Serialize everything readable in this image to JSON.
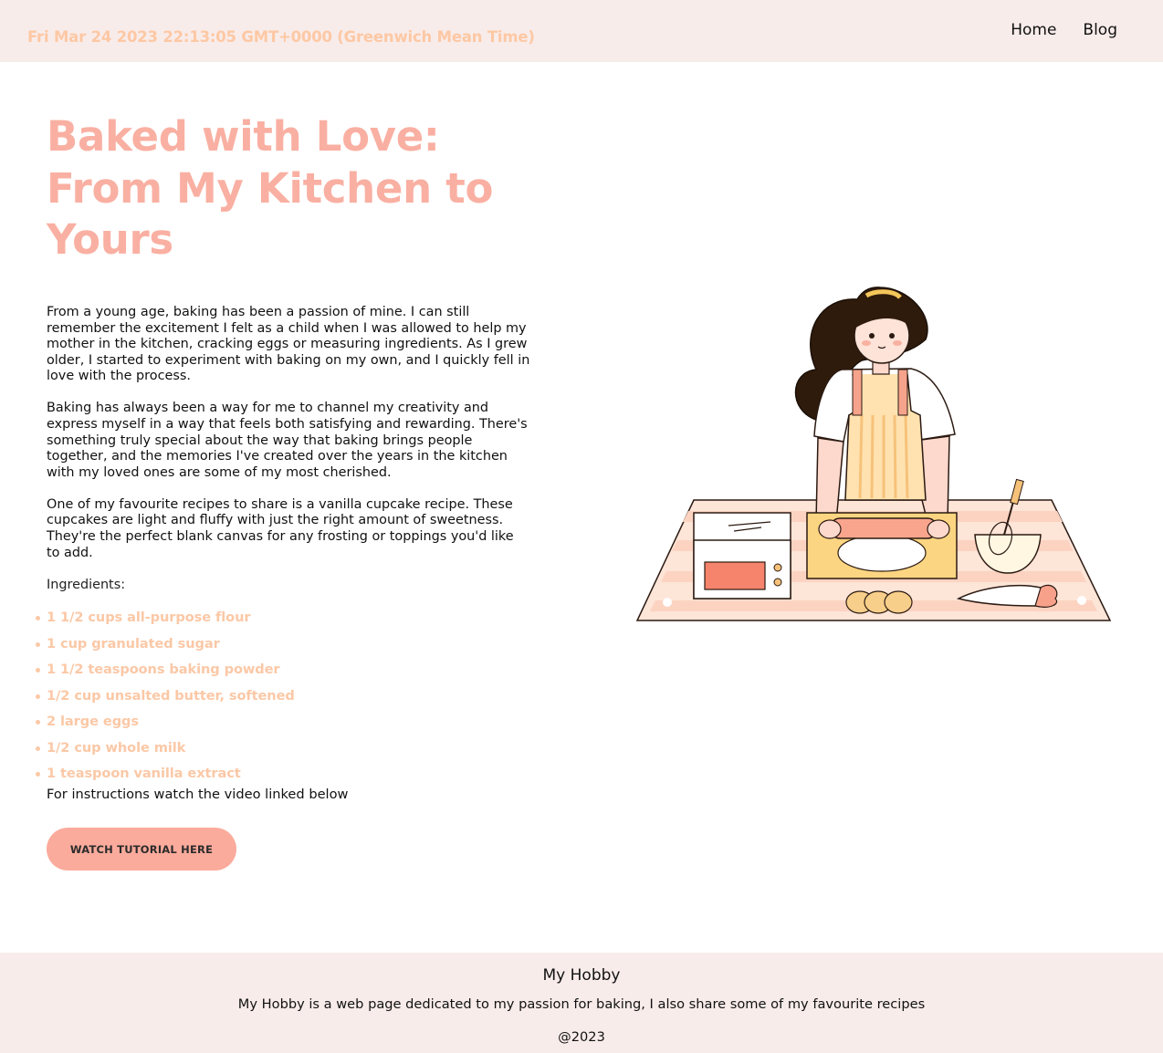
{
  "header": {
    "datetime": "Fri Mar 24 2023 22:13:05 GMT+0000 (Greenwich Mean Time)",
    "nav": [
      {
        "label": "Home"
      },
      {
        "label": "Blog"
      }
    ]
  },
  "hero": {
    "title": "Baked with Love: From My Kitchen to Yours"
  },
  "content": {
    "paragraphs": [
      "From a young age, baking has been a passion of mine. I can still remember the excitement I felt as a child when I was allowed to help my mother in the kitchen, cracking eggs or measuring ingredients. As I grew older, I started to experiment with baking on my own, and I quickly fell in love with the process.",
      "Baking has always been a way for me to channel my creativity and express myself in a way that feels both satisfying and rewarding. There's something truly special about the way that baking brings people together, and the memories I've created over the years in the kitchen with my loved ones are some of my most cherished.",
      "One of my favourite recipes to share is a vanilla cupcake recipe. These cupcakes are light and fluffy with just the right amount of sweetness. They're the perfect blank canvas for any frosting or toppings you'd like to add."
    ],
    "ingredients_label": "Ingredients:",
    "ingredients": [
      "1 1/2 cups all-purpose flour",
      "1 cup granulated sugar",
      "1 1/2 teaspoons baking powder",
      "1/2 cup unsalted butter, softened",
      "2 large eggs",
      "1/2 cup whole milk",
      "1 teaspoon vanilla extract"
    ],
    "instructions": "For instructions watch the video linked below",
    "button_label": "WATCH TUTORIAL HERE"
  },
  "illustration": {
    "icon": "baking-woman-illustration"
  },
  "footer": {
    "title": "My Hobby",
    "description": "My Hobby is a web page dedicated to my passion for baking, I also share some of my favourite recipes",
    "copyright": "@2023"
  },
  "colors": {
    "accent": "#f9b0a2",
    "list_text": "#fbc8a6",
    "header_bg": "#f8ecea",
    "button_bg": "#fbab9c"
  }
}
